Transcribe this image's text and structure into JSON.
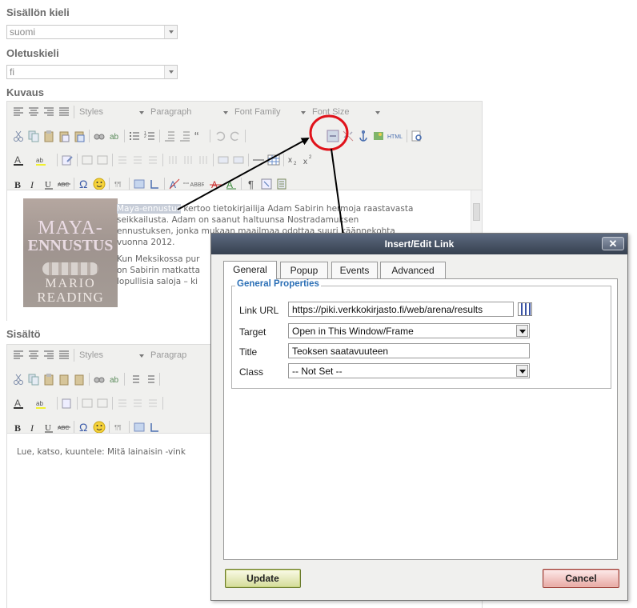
{
  "form": {
    "content_lang_label": "Sisällön kieli",
    "content_lang_value": "suomi",
    "default_lang_label": "Oletuskieli",
    "default_lang_value": "fi",
    "desc_label": "Kuvaus",
    "content_label": "Sisältö"
  },
  "toolbar": {
    "styles": "Styles",
    "format": "Paragraph",
    "font_family": "Font Family",
    "font_size": "Font Size",
    "paragraph_short": "Paragrap"
  },
  "description": {
    "highlight": "Maya-ennustus",
    "line1_rest": " kertoo tietokirjailija Adam Sabirin hermoja raastavasta",
    "line2": "seikkailusta. Adam on saanut haltuunsa Nostradamuksen",
    "line3": "ennustuksen, jonka mukaan maailmaa odottaa suuri käännekohta",
    "line4": "vuonna 2012.",
    "line5": "Kun Meksikossa pur",
    "line6": "on Sabirin matkatta",
    "line7": "lopullisia saloja – ki",
    "cover_title_1": "MAYA-",
    "cover_title_2": "ENNUSTUS",
    "cover_author_1": "MARIO",
    "cover_author_2": "READING"
  },
  "content": {
    "text": "Lue, katso, kuuntele: Mitä lainaisin -vink"
  },
  "dialog": {
    "title": "Insert/Edit Link",
    "tabs": [
      "General",
      "Popup",
      "Events",
      "Advanced"
    ],
    "legend": "General Properties",
    "link_url_label": "Link URL",
    "link_url_value": "https://piki.verkkokirjasto.fi/web/arena/results",
    "target_label": "Target",
    "target_value": "Open in This Window/Frame",
    "title_label": "Title",
    "title_value": "Teoksen saatavuuteen",
    "class_label": "Class",
    "class_value": "-- Not Set --",
    "update": "Update",
    "cancel": "Cancel"
  },
  "colors": {
    "accent_legend": "#2b6fb6",
    "annotation_circle": "#e0131b",
    "titlebar": "#3f4a5b"
  }
}
